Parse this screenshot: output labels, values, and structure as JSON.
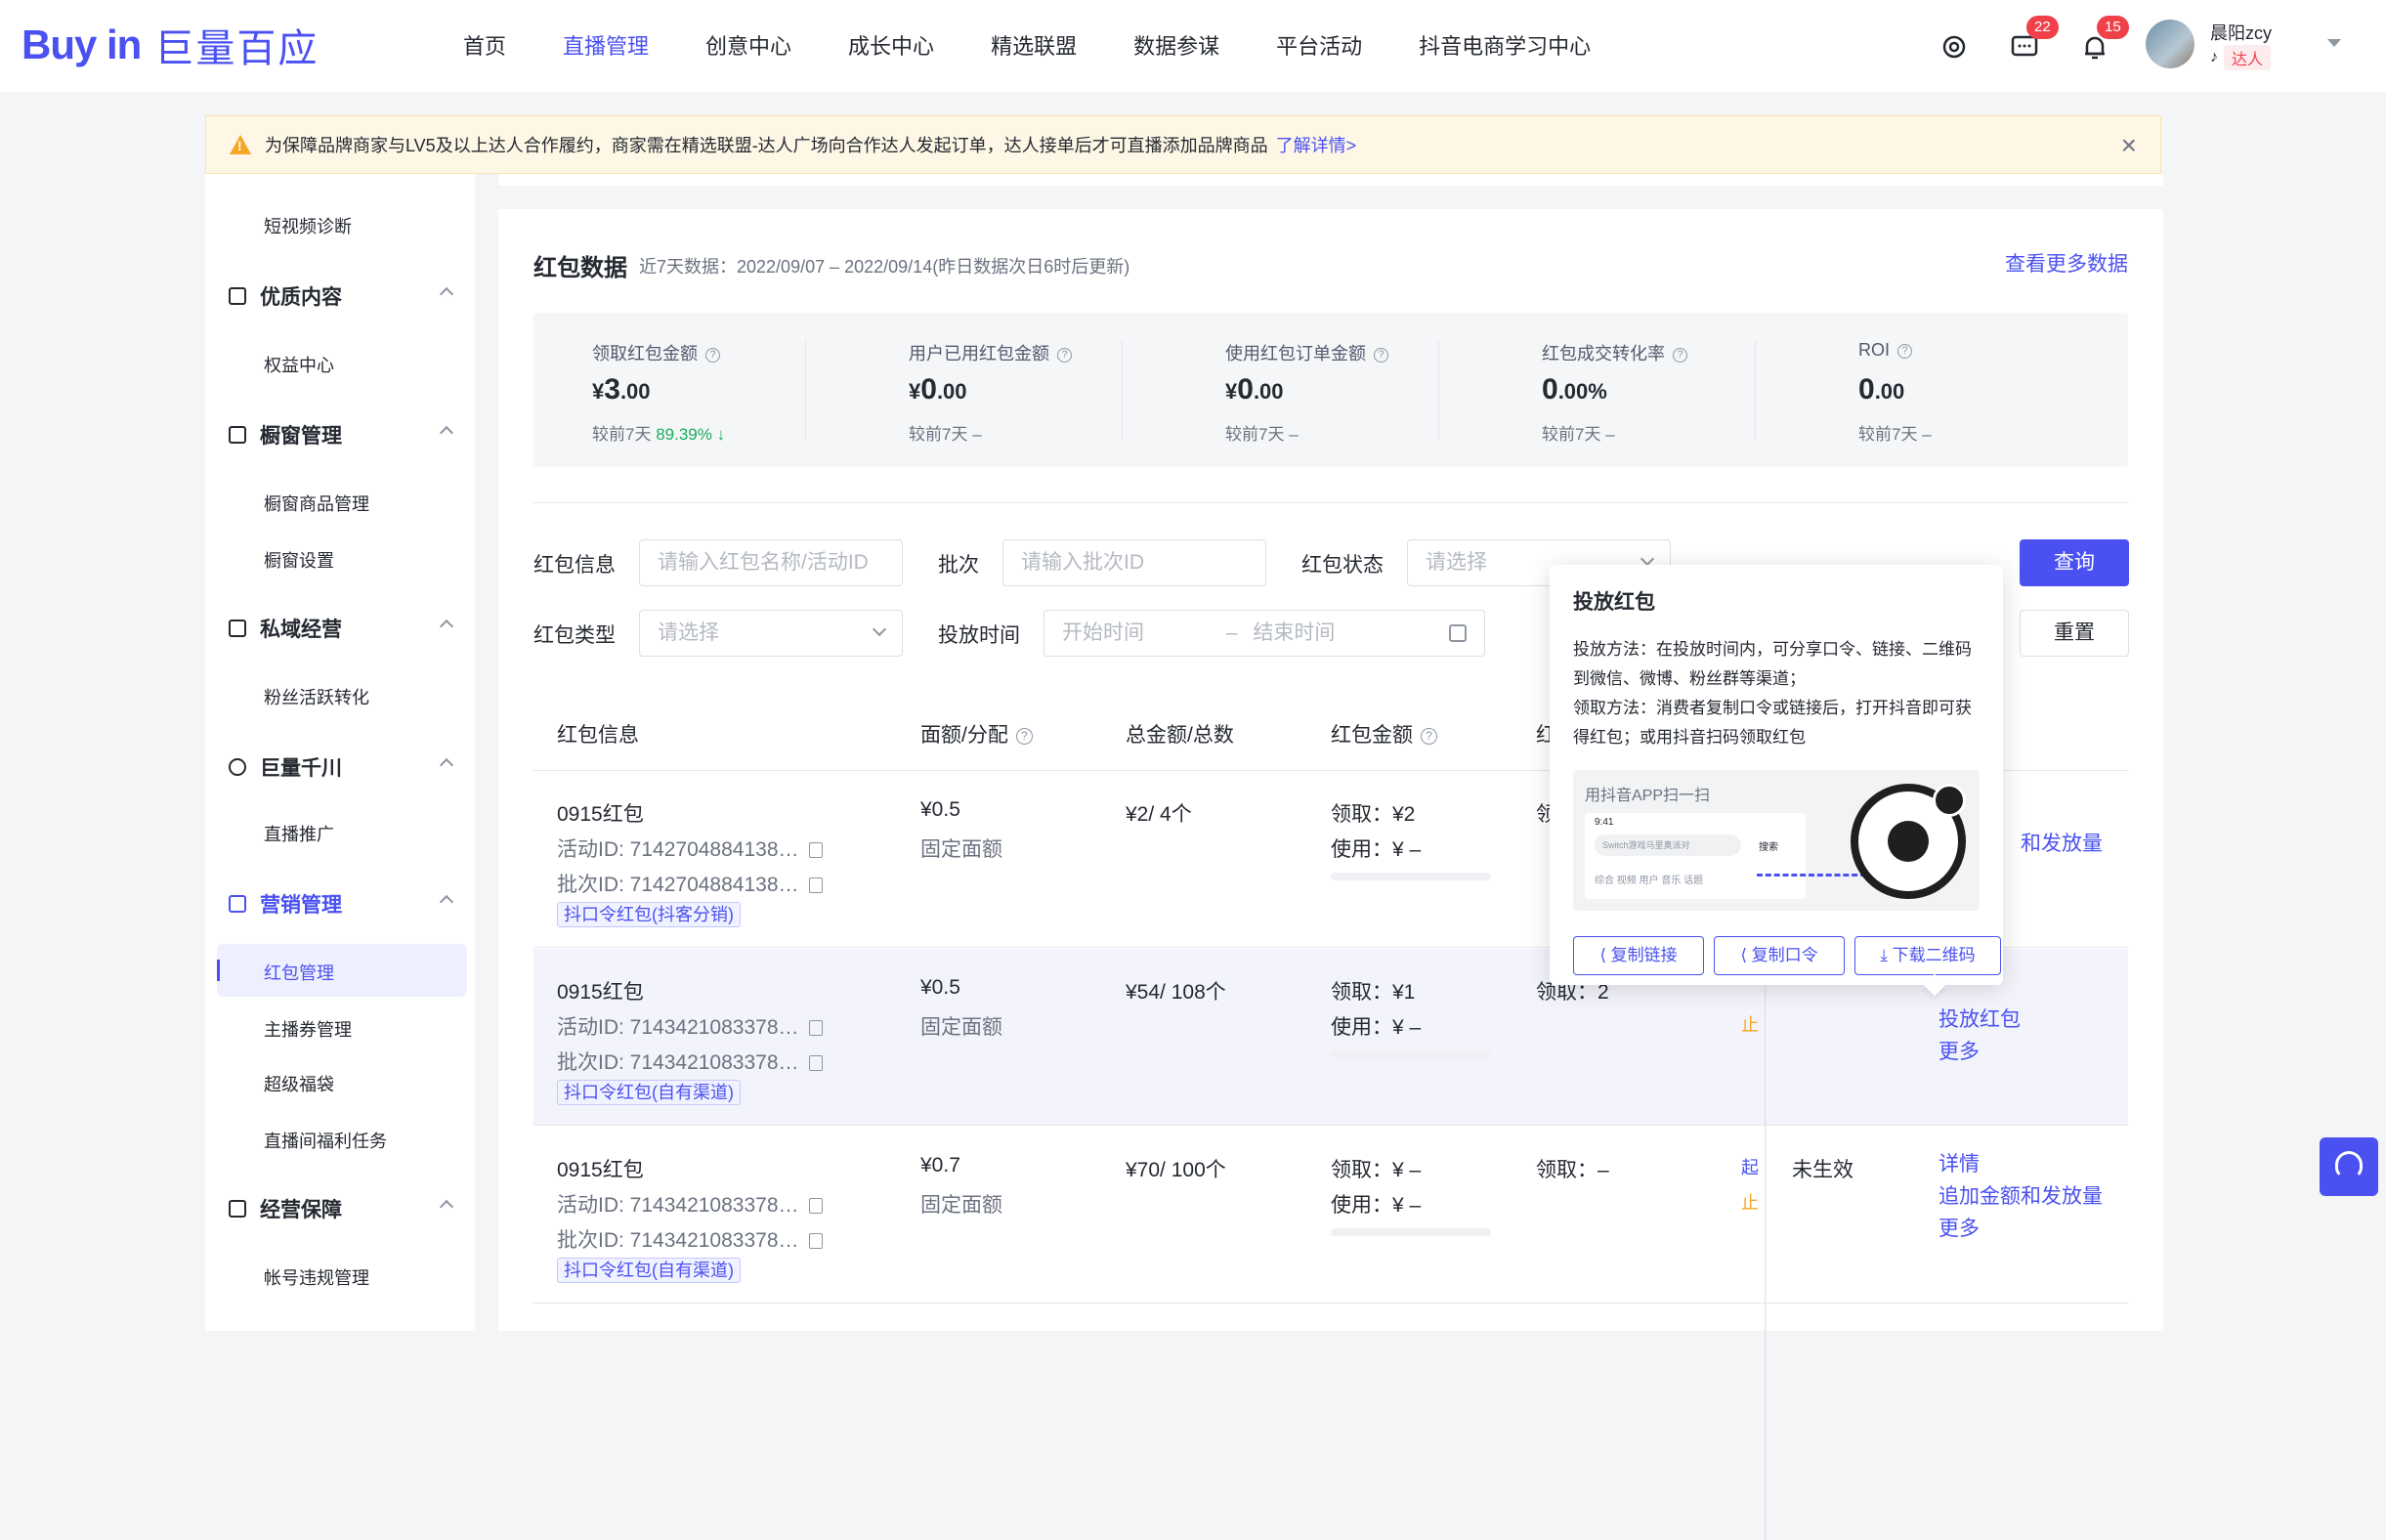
{
  "brand": {
    "logo_en": "Buy in",
    "logo_cn": "巨量百应"
  },
  "nav": [
    "首页",
    "直播管理",
    "创意中心",
    "成长中心",
    "精选联盟",
    "数据参谋",
    "平台活动",
    "抖音电商学习中心"
  ],
  "nav_active_index": 1,
  "header": {
    "message_badge": "22",
    "notify_badge": "15",
    "username": "晨阳zcy",
    "role": "达人"
  },
  "notice": {
    "text": "为保障品牌商家与LV5及以上达人合作履约，商家需在精选联盟-达人广场向合作达人发起订单，达人接单后才可直播添加品牌商品",
    "link": "了解详情>"
  },
  "sidebar": {
    "items": [
      {
        "label": "短视频诊断"
      },
      {
        "group": "优质内容"
      },
      {
        "label": "权益中心"
      },
      {
        "group": "橱窗管理"
      },
      {
        "label": "橱窗商品管理"
      },
      {
        "label": "橱窗设置"
      },
      {
        "group": "私域经营"
      },
      {
        "label": "粉丝活跃转化"
      },
      {
        "group": "巨量千川"
      },
      {
        "label": "直播推广"
      },
      {
        "group": "营销管理"
      },
      {
        "label": "红包管理"
      },
      {
        "label": "主播券管理"
      },
      {
        "label": "超级福袋"
      },
      {
        "label": "直播间福利任务"
      },
      {
        "group": "经营保障"
      },
      {
        "label": "帐号违规管理"
      }
    ]
  },
  "section": {
    "title": "红包数据",
    "subtitle": "近7天数据：2022/09/07 – 2022/09/14(昨日数据次日6时后更新)",
    "more": "查看更多数据"
  },
  "stats": [
    {
      "label": "领取红包金额",
      "prefix": "¥",
      "big": "3",
      "small": ".00",
      "cmp_label": "较前7天",
      "cmp_value": "89.39% ↓"
    },
    {
      "label": "用户已用红包金额",
      "prefix": "¥",
      "big": "0",
      "small": ".00",
      "cmp_label": "较前7天",
      "cmp_value": "–"
    },
    {
      "label": "使用红包订单金额",
      "prefix": "¥",
      "big": "0",
      "small": ".00",
      "cmp_label": "较前7天",
      "cmp_value": "–"
    },
    {
      "label": "红包成交转化率",
      "prefix": "",
      "big": "0",
      "small": ".00%",
      "cmp_label": "较前7天",
      "cmp_value": "–"
    },
    {
      "label": "ROI",
      "prefix": "",
      "big": "0",
      "small": ".00",
      "cmp_label": "较前7天",
      "cmp_value": "–"
    }
  ],
  "filters": {
    "info_label": "红包信息",
    "info_placeholder": "请输入红包名称/活动ID",
    "batch_label": "批次",
    "batch_placeholder": "请输入批次ID",
    "status_label": "红包状态",
    "status_placeholder": "请选择",
    "type_label": "红包类型",
    "type_placeholder": "请选择",
    "time_label": "投放时间",
    "start_placeholder": "开始时间",
    "end_placeholder": "结束时间",
    "time_sep": "–",
    "query": "查询",
    "reset": "重置"
  },
  "table": {
    "headers": [
      "红包信息",
      "面额/分配",
      "总金额/总数",
      "红包金额",
      "红"
    ],
    "rows": [
      {
        "name": "0915红包",
        "activity": "活动ID: 7142704884138…",
        "batch": "批次ID: 7142704884138…",
        "tag": "抖口令红包(抖客分销)",
        "face": "¥0.5",
        "alloc": "固定面额",
        "total": "¥2/ 4个",
        "claim": "领取：¥2",
        "used": "使用：¥ –",
        "col5": "领",
        "status": "",
        "actions": [
          "和发放量"
        ]
      },
      {
        "name": "0915红包",
        "activity": "活动ID: 7143421083378…",
        "batch": "批次ID: 7143421083378…",
        "tag": "抖口令红包(自有渠道)",
        "face": "¥0.5",
        "alloc": "固定面额",
        "total": "¥54/ 108个",
        "claim": "领取：¥1",
        "used": "使用：¥ –",
        "col5": "领取：2",
        "status": "",
        "actions": [
          "投放红包",
          "更多"
        ]
      },
      {
        "name": "0915红包",
        "activity": "活动ID: 7143421083378…",
        "batch": "批次ID: 7143421083378…",
        "tag": "抖口令红包(自有渠道)",
        "face": "¥0.7",
        "alloc": "固定面额",
        "total": "¥70/ 100个",
        "claim": "领取：¥ –",
        "used": "使用：¥ –",
        "col5": "领取：–",
        "status": "未生效",
        "actions": [
          "详情",
          "追加金额和发放量",
          "更多"
        ]
      }
    ],
    "time_marks": [
      "起",
      "止"
    ]
  },
  "popover": {
    "title": "投放红包",
    "line1": "投放方法：在投放时间内，可分享口令、链接、二维码到微信、微博、粉丝群等渠道；",
    "line2": "领取方法：消费者复制口令或链接后，打开抖音即可获得红包；或用抖音扫码领取红包",
    "scan_label": "用抖音APP扫一扫",
    "phone_time": "9:41",
    "phone_search": "Switch游戏马里奥派对",
    "phone_search_btn": "搜索",
    "phone_tabs": "综合   视频   用户   音乐   话题",
    "buttons": [
      "复制链接",
      "复制口令",
      "下载二维码"
    ]
  },
  "colors": {
    "brand": "#4a51f0",
    "warn": "#f5a623",
    "up": "#1aad5c",
    "badge": "#f0414b"
  }
}
